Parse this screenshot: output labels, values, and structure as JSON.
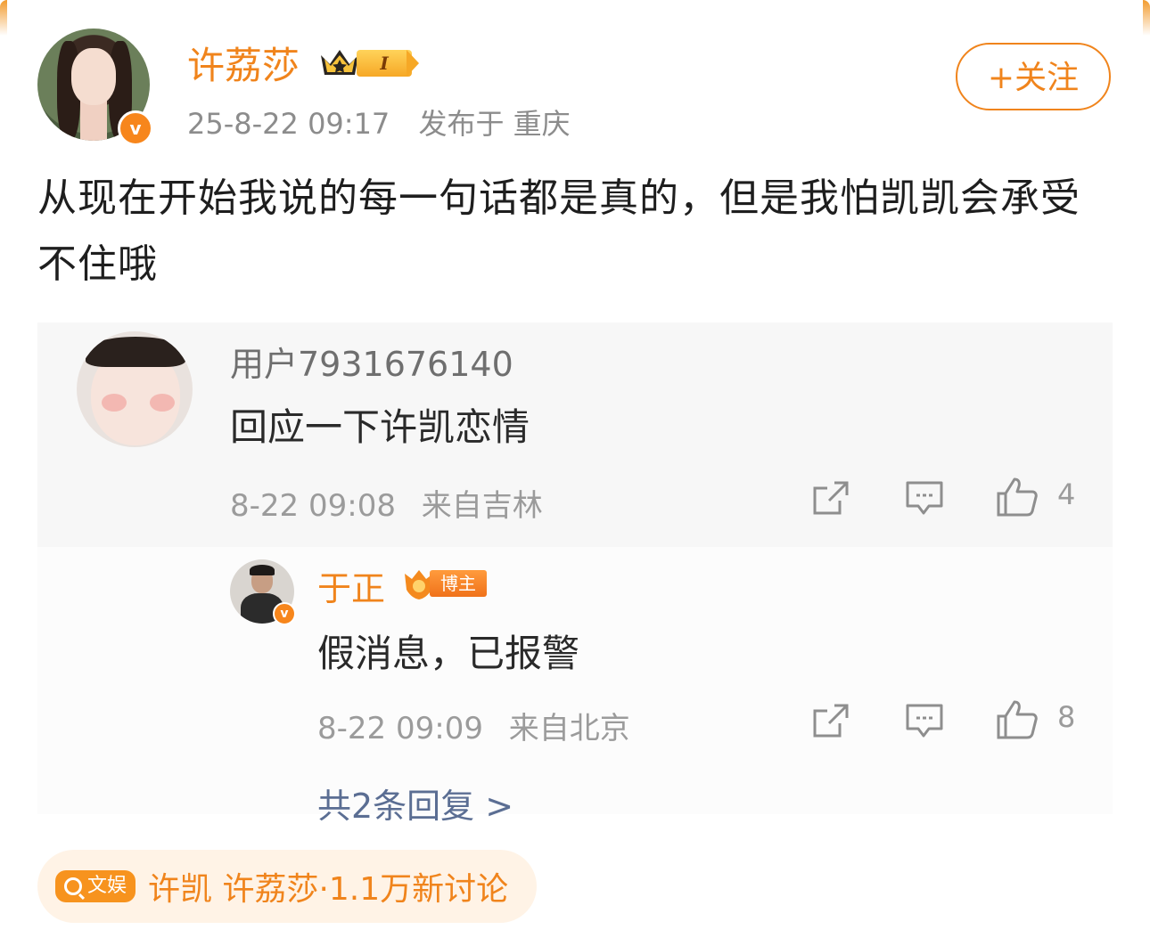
{
  "post": {
    "author": "许荔莎",
    "level_badge": "I",
    "date": "25-8-22 09:17",
    "published_at": "发布于 重庆",
    "follow_label": "+关注",
    "verified_mark": "v",
    "text": "从现在开始我说的每一句话都是真的，但是我怕凯凯会承受不住哦"
  },
  "comment": {
    "user": "用户7931676140",
    "text": "回应一下许凯恋情",
    "date": "8-22 09:08",
    "source": "来自吉林",
    "likes": "4",
    "icons": [
      "share-icon",
      "comment-icon",
      "like-icon"
    ]
  },
  "reply": {
    "user": "于正",
    "badge": "博主",
    "text": "假消息，已报警",
    "date": "8-22 09:09",
    "source": "来自北京",
    "likes": "8",
    "verified_mark": "v"
  },
  "more_replies": "共2条回复 >",
  "topic": {
    "tag": "文娱",
    "text": "许凯 许荔莎·1.1万新讨论"
  },
  "colors": {
    "accent": "#f0841c",
    "link": "#5b6e93",
    "muted": "#9b9b9b"
  }
}
